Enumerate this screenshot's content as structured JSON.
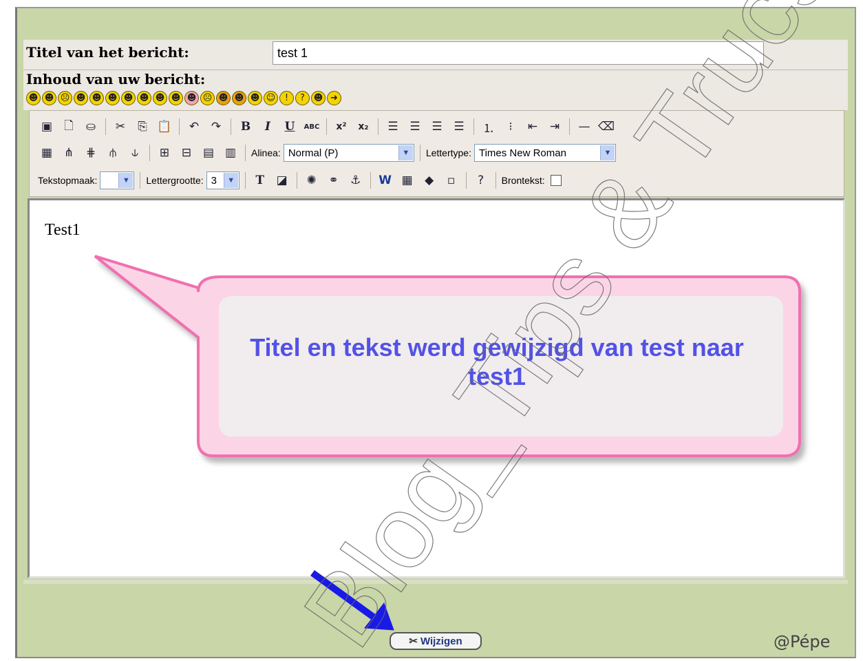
{
  "form": {
    "title_label": "Titel van het bericht:",
    "title_value": "test 1",
    "content_label": "Inhoud van uw bericht:"
  },
  "smileys": [
    "☻",
    "☻",
    "☹",
    "☻",
    "☻",
    "☻",
    "☻",
    "☻",
    "☻",
    "☻",
    "☻",
    "☹",
    "☻",
    "☻",
    "☻",
    "☺",
    "!",
    "?",
    "☻",
    "➜"
  ],
  "toolbar": {
    "alinea_label": "Alinea:",
    "alinea_value": "Normal (P)",
    "lettertype_label": "Lettertype:",
    "lettertype_value": "Times New Roman",
    "tekstopmaak_label": "Tekstopmaak:",
    "tekstopmaak_value": "",
    "lettergrootte_label": "Lettergrootte:",
    "lettergrootte_value": "3",
    "brontekst_label": "Brontekst:"
  },
  "editor": {
    "content": "Test1"
  },
  "callout": {
    "text": "Titel en tekst werd gewijzigd van test naar test1"
  },
  "save_button": {
    "label": "Wijzigen"
  },
  "watermark": {
    "text": "Blog_Tips & Trucs"
  },
  "copyright": "@Pépe",
  "colors": {
    "page_background": "#c9d6a8",
    "callout_border": "#f06fb0",
    "callout_text": "#5252e6",
    "arrow": "#1a1ae6"
  }
}
